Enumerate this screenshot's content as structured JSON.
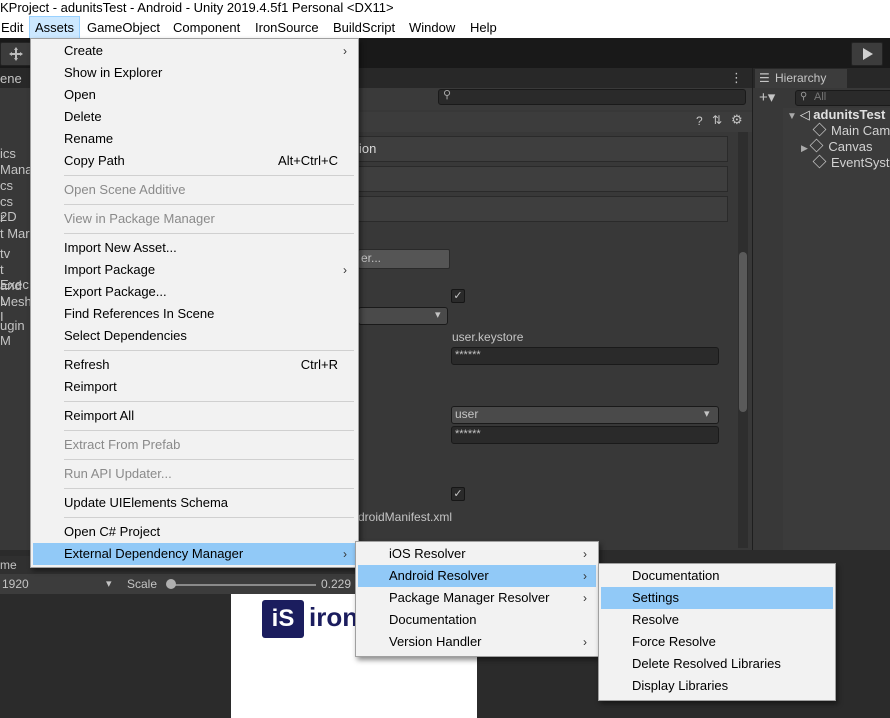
{
  "window": {
    "title": "KProject - adunitsTest - Android - Unity 2019.4.5f1 Personal <DX11>"
  },
  "menubar": {
    "items": [
      "Edit",
      "Assets",
      "GameObject",
      "Component",
      "IronSource",
      "BuildScript",
      "Window",
      "Help"
    ],
    "open": "Assets"
  },
  "scene_panel": {
    "tab": "ene",
    "clipped_items": [
      "ics",
      "Mana",
      "cs",
      "cs 2D",
      "r",
      "t Mar",
      "tv",
      "t Exec",
      "and L",
      "Mesh I",
      "ugin M"
    ]
  },
  "inspector": {
    "section_header": "ion",
    "button_text": "er...",
    "keystore_path": "user.keystore",
    "keystore_password": "******",
    "alias": "user",
    "alias_password": "******",
    "manifest_text": "droidManifest.xml"
  },
  "game_view": {
    "label": "me",
    "resolution": "1920",
    "scale_label": "Scale",
    "scale_value": "0.229",
    "logo_letters": "iS",
    "logo_text": "iron"
  },
  "hierarchy": {
    "tab": "Hierarchy",
    "search_placeholder": "All",
    "scene": "adunitsTest",
    "children": [
      "Main Camera",
      "Canvas",
      "EventSystem"
    ]
  },
  "assets_menu": [
    {
      "label": "Create",
      "arrow": true
    },
    {
      "label": "Show in Explorer"
    },
    {
      "label": "Open"
    },
    {
      "label": "Delete"
    },
    {
      "label": "Rename"
    },
    {
      "label": "Copy Path",
      "shortcut": "Alt+Ctrl+C"
    },
    {
      "label": "Open Scene Additive",
      "disabled": true
    },
    {
      "label": "View in Package Manager",
      "disabled": true
    },
    {
      "label": "Import New Asset..."
    },
    {
      "label": "Import Package",
      "arrow": true
    },
    {
      "label": "Export Package..."
    },
    {
      "label": "Find References In Scene"
    },
    {
      "label": "Select Dependencies"
    },
    {
      "label": "Refresh",
      "shortcut": "Ctrl+R"
    },
    {
      "label": "Reimport"
    },
    {
      "label": "Reimport All"
    },
    {
      "label": "Extract From Prefab",
      "disabled": true
    },
    {
      "label": "Run API Updater...",
      "disabled": true
    },
    {
      "label": "Update UIElements Schema"
    },
    {
      "label": "Open C# Project"
    },
    {
      "label": "External Dependency Manager",
      "arrow": true,
      "highlighted": true
    }
  ],
  "edm_menu": [
    {
      "label": "iOS Resolver",
      "arrow": true
    },
    {
      "label": "Android Resolver",
      "arrow": true,
      "highlighted": true
    },
    {
      "label": "Package Manager Resolver",
      "arrow": true
    },
    {
      "label": "Documentation"
    },
    {
      "label": "Version Handler",
      "arrow": true
    }
  ],
  "android_menu": [
    {
      "label": "Documentation"
    },
    {
      "label": "Settings",
      "highlighted": true
    },
    {
      "label": "Resolve"
    },
    {
      "label": "Force Resolve"
    },
    {
      "label": "Delete Resolved Libraries"
    },
    {
      "label": "Display Libraries"
    }
  ],
  "glyphs": {
    "arrow": "›",
    "check": "✓",
    "dropdown": "▾"
  }
}
